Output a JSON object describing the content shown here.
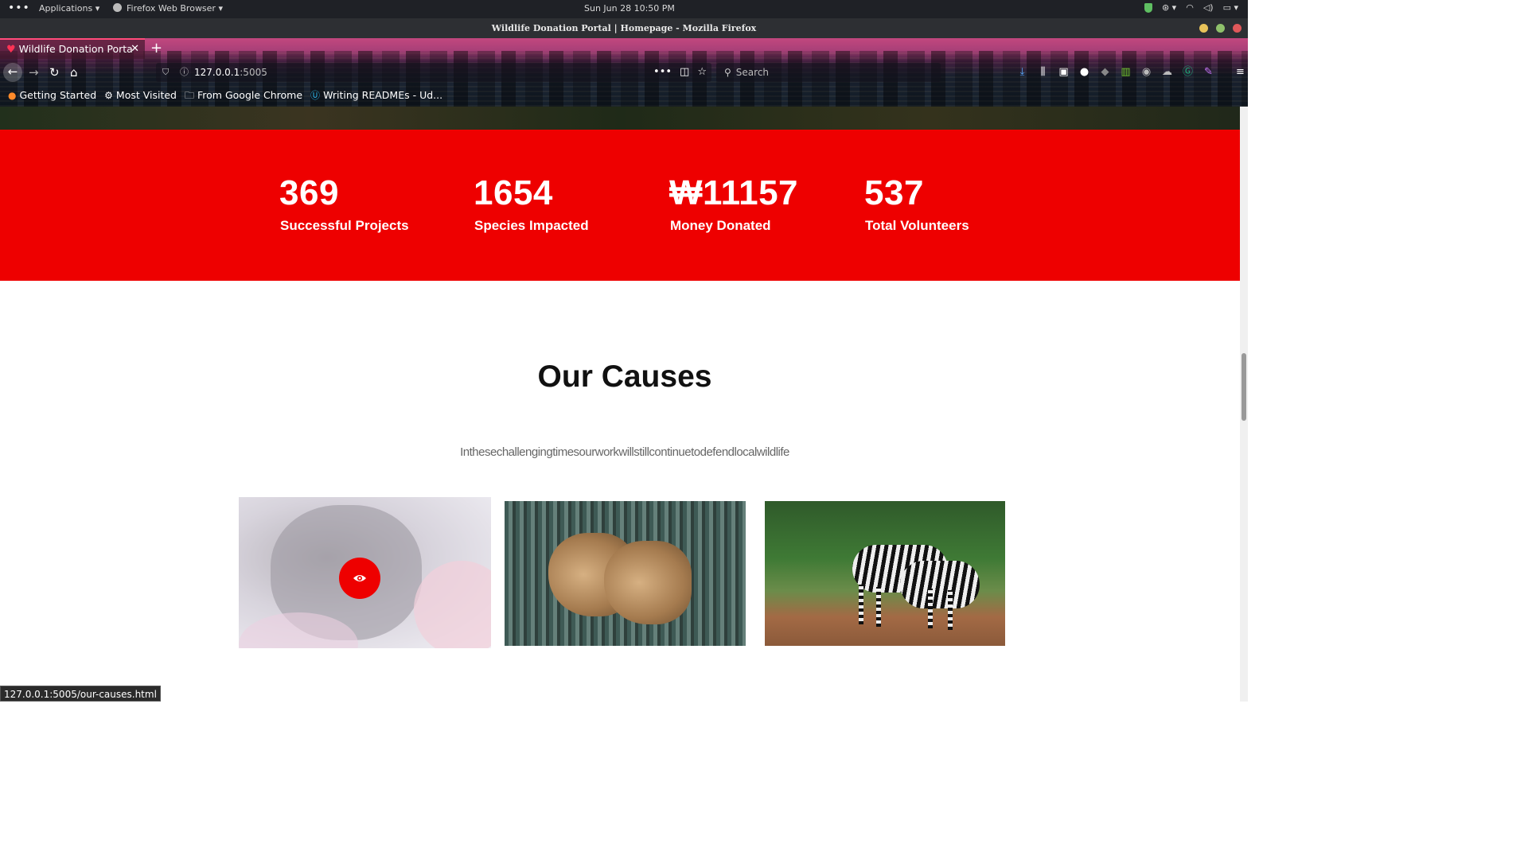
{
  "system": {
    "menu_dots": "•••",
    "applications": "Applications ▾",
    "active_app": "Firefox Web Browser ▾",
    "clock": "Sun Jun 28  10:50 PM"
  },
  "window": {
    "title": "Wildlife Donation Portal | Homepage - Mozilla Firefox"
  },
  "browser": {
    "tab_title": "Wildlife Donation Porta",
    "url_host": "127.0.0.1",
    "url_port": ":5005",
    "search_placeholder": "Search",
    "bookmarks": [
      {
        "label": "Getting Started",
        "icon": "firefox-icon"
      },
      {
        "label": "Most Visited",
        "icon": "gear-icon"
      },
      {
        "label": "From Google Chrome",
        "icon": "folder-icon"
      },
      {
        "label": "Writing READMEs - Ud...",
        "icon": "udacity-icon"
      }
    ]
  },
  "stats": [
    {
      "value": "369",
      "label": "Successful Projects"
    },
    {
      "value": "1654",
      "label": "Species Impacted"
    },
    {
      "value": "₩11157",
      "label": "Money Donated"
    },
    {
      "value": "537",
      "label": "Total Volunteers"
    }
  ],
  "causes": {
    "title": "Our Causes",
    "subtitle": "Inthesechallengingtimesourworkwillstillcontinuetodefendlocalwildlife"
  },
  "status_url": "127.0.0.1:5005/our-causes.html",
  "colors": {
    "accent_red": "#ee0000"
  }
}
